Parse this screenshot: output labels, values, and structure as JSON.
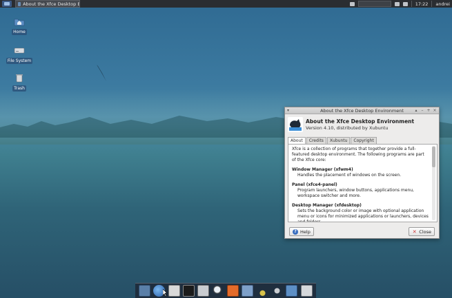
{
  "top_panel": {
    "task_title": "About the Xfce Desktop Environment",
    "clock": "17:22",
    "user": "andrei",
    "icons": [
      "applications-menu-icon",
      "mail-icon",
      "volume-icon",
      "network-icon"
    ]
  },
  "desktop": {
    "icons": [
      {
        "label": "Home",
        "icon": "home-folder-icon"
      },
      {
        "label": "File System",
        "icon": "drive-icon"
      },
      {
        "label": "Trash",
        "icon": "trash-icon"
      }
    ]
  },
  "dialog": {
    "title": "About the Xfce Desktop Environment",
    "heading": "About the Xfce Desktop Environment",
    "version": "Version 4.10, distributed by Xubuntu",
    "tabs": [
      "About",
      "Credits",
      "Xubuntu",
      "Copyright"
    ],
    "active_tab": "About",
    "intro": "Xfce is a collection of programs that together provide a full-featured desktop environment. The following programs are part of the Xfce core:",
    "sections": [
      {
        "title": "Window Manager (xfwm4)",
        "desc": "Handles the placement of windows on the screen."
      },
      {
        "title": "Panel (xfce4-panel)",
        "desc": "Program launchers, window buttons, applications menu, workspace switcher and more."
      },
      {
        "title": "Desktop Manager (xfdesktop)",
        "desc": "Sets the background color or image with optional application menu or icons for minimized applications or launchers, devices and folders."
      }
    ],
    "help_label": "Help",
    "close_label": "Close"
  },
  "dock": {
    "items": [
      "show-desktop-icon",
      "web-browser-icon",
      "file-manager-icon",
      "terminal-icon",
      "settings-icon",
      "search-icon",
      "software-center-icon",
      "text-editor-icon",
      "music-player-icon",
      "mail-client-icon",
      "folder-icon",
      "trash-icon"
    ]
  },
  "colors": {
    "panel_bg": "#2a2d31",
    "dialog_bg": "#edeceb",
    "help_accent": "#3a6fc0"
  }
}
